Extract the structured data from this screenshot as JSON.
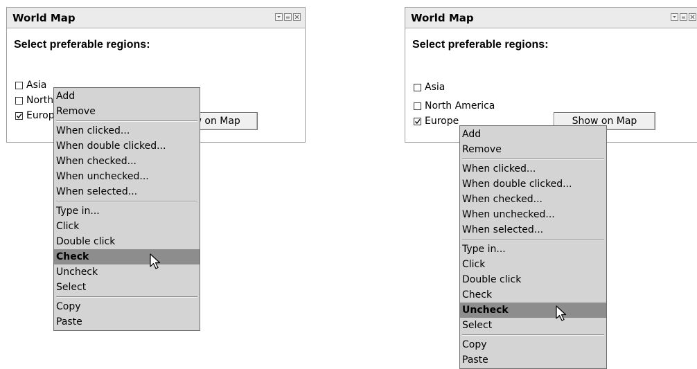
{
  "panels": [
    {
      "title": "World Map",
      "heading": "Select preferable regions:",
      "checkboxes": [
        {
          "label": "Asia",
          "checked": false
        },
        {
          "label": "North America",
          "checked": false
        },
        {
          "label": "Europe",
          "checked": true
        }
      ],
      "button": "Show on Map",
      "window_controls": [
        "menu-icon",
        "minimize-icon",
        "close-icon"
      ],
      "context_menu": {
        "groups": [
          [
            "Add",
            "Remove"
          ],
          [
            "When clicked...",
            "When double clicked...",
            "When checked...",
            "When unchecked...",
            "When selected..."
          ],
          [
            "Type in...",
            "Click",
            "Double click",
            "Check",
            "Uncheck",
            "Select"
          ],
          [
            "Copy",
            "Paste"
          ]
        ],
        "highlighted": "Check"
      }
    },
    {
      "title": "World Map",
      "heading": "Select preferable regions:",
      "checkboxes": [
        {
          "label": "Asia",
          "checked": false
        },
        {
          "label": "North America",
          "checked": false
        },
        {
          "label": "Europe",
          "checked": true
        }
      ],
      "button": "Show on Map",
      "window_controls": [
        "menu-icon",
        "minimize-icon",
        "close-icon"
      ],
      "context_menu": {
        "groups": [
          [
            "Add",
            "Remove"
          ],
          [
            "When clicked...",
            "When double clicked...",
            "When checked...",
            "When unchecked...",
            "When selected..."
          ],
          [
            "Type in...",
            "Click",
            "Double click",
            "Check",
            "Uncheck",
            "Select"
          ],
          [
            "Copy",
            "Paste"
          ]
        ],
        "highlighted": "Uncheck"
      }
    }
  ]
}
